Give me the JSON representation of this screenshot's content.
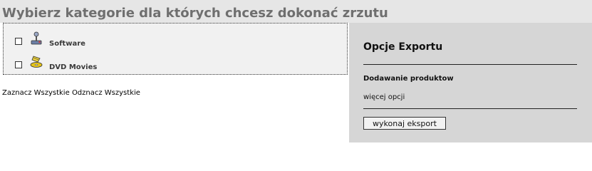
{
  "header": {
    "title": "Wybierz kategorie dla których chcesz dokonać zrzutu"
  },
  "categories": {
    "items": [
      {
        "label": "Software",
        "checked": false,
        "icon": "joystick-icon"
      },
      {
        "label": "DVD Movies",
        "checked": false,
        "icon": "dvd-icon"
      }
    ]
  },
  "selection": {
    "select_all": "Zaznacz Wszystkie",
    "deselect_all": "Odznacz Wszystkie"
  },
  "export": {
    "title": "Opcje Exportu",
    "add_products": "Dodawanie produktow",
    "more_options": "więcej opcji",
    "run_button": "wykonaj eksport"
  }
}
